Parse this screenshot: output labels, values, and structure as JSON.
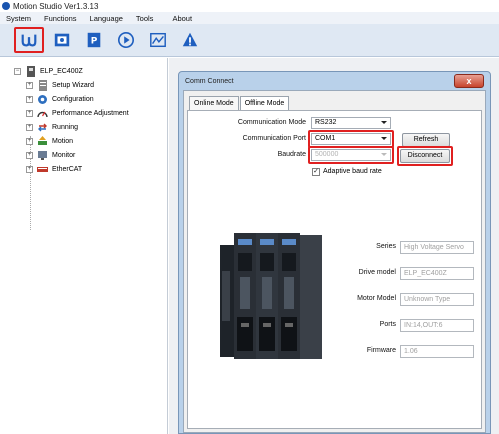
{
  "window": {
    "title": "Motion Studio Ver1.3.13"
  },
  "menu": [
    "System",
    "Functions",
    "Language",
    "Tools",
    "About"
  ],
  "toolbar": [
    {
      "icon": "connect-icon"
    },
    {
      "icon": "monitor-screen-icon"
    },
    {
      "icon": "parameter-icon"
    },
    {
      "icon": "run-icon"
    },
    {
      "icon": "scope-icon"
    },
    {
      "icon": "alarm-icon"
    }
  ],
  "tree": {
    "root": "ELP_EC400Z",
    "items": [
      "Setup Wizard",
      "Configuration",
      "Performance Adjustment",
      "Running",
      "Motion",
      "Monitor",
      "EtherCAT"
    ]
  },
  "dialog": {
    "title": "Comm Connect",
    "close": "x",
    "tabs": [
      "Online Mode",
      "Offline Mode"
    ],
    "comm_mode_label": "Communication Mode",
    "comm_mode_value": "RS232",
    "comm_port_label": "Communication Port",
    "comm_port_value": "COM1",
    "refresh_label": "Refresh",
    "baudrate_label": "Baudrate",
    "baudrate_value": "500000",
    "disconnect_label": "Disconnect",
    "adaptive_label": "Adaptive baud rate",
    "adaptive_checked": "✓"
  },
  "info": {
    "series_label": "Series",
    "series_value": "High Voltage Servo",
    "drive_model_label": "Drive model",
    "drive_model_value": "ELP_EC400Z",
    "motor_model_label": "Motor Model",
    "motor_model_value": "Unknown Type",
    "ports_label": "Ports",
    "ports_value": "IN:14,OUT:6",
    "firmware_label": "Firmware",
    "firmware_value": "1.06"
  },
  "colors": {
    "highlight": "#e02020",
    "toolbar_bg": "#dfe8f3",
    "dialog_frame": "#b9d1ea"
  }
}
